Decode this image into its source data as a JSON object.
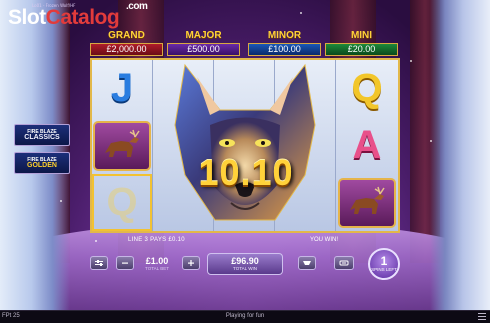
{
  "watermark": {
    "brand_a": "Slot",
    "brand_b": "Catalog",
    "suffix": ".com"
  },
  "game_id": "Lo01 - Frozen Wolf/HF",
  "jackpots": [
    {
      "name": "GRAND",
      "amount": "£2,000.00"
    },
    {
      "name": "MAJOR",
      "amount": "£500.00"
    },
    {
      "name": "MINOR",
      "amount": "£100.00"
    },
    {
      "name": "MINI",
      "amount": "£20.00"
    }
  ],
  "side_buttons": [
    {
      "top_text": "FIRE BLAZE",
      "main_text": "CLASSICS"
    },
    {
      "top_text": "FIRE BLAZE",
      "main_text": "GOLDEN"
    }
  ],
  "reels": [
    [
      "J",
      "elk",
      "Q"
    ],
    [
      "wolf",
      "wolf",
      "wolf"
    ],
    [
      "wolf",
      "wolf",
      "wolf"
    ],
    [
      "wolf",
      "wolf",
      "wolf"
    ],
    [
      "Q",
      "A",
      "elk"
    ]
  ],
  "win_amount": "10.10",
  "paylines_text": "LINE 3 PAYS £0.10",
  "you_win_label": "YOU WIN!",
  "total_bet": {
    "value": "£1.00",
    "label": "TOTAL BET"
  },
  "total_win": {
    "value": "£96.90",
    "label": "TOTAL WIN"
  },
  "spins": {
    "count": "1",
    "label": "SPINS LEFT"
  },
  "bottom_bar": {
    "left": "FPt 25",
    "center": "Playing for fun"
  },
  "colors": {
    "gold": "#ffd23a",
    "reel_border": "#e2b84a",
    "grand": "#b01c2a",
    "major": "#6a2aa8",
    "minor": "#1a58b8",
    "mini": "#1c8a3a"
  }
}
